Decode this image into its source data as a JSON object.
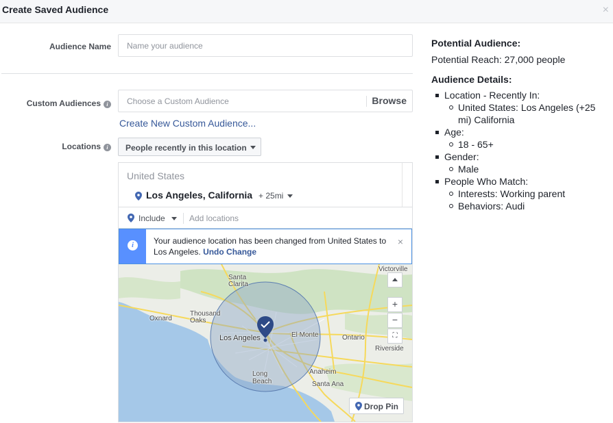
{
  "dialog": {
    "title": "Create Saved Audience",
    "close_icon": "×"
  },
  "form": {
    "audience_name": {
      "label": "Audience Name",
      "placeholder": "Name your audience"
    },
    "custom_audiences": {
      "label": "Custom Audiences",
      "placeholder": "Choose a Custom Audience",
      "browse_label": "Browse",
      "create_link": "Create New Custom Audience..."
    },
    "locations": {
      "label": "Locations",
      "dropdown_value": "People recently in this location",
      "country": "United States",
      "selected_location": "Los Angeles, California",
      "radius": "+ 25mi",
      "include_label": "Include",
      "add_placeholder": "Add locations",
      "notice": {
        "text": "Your audience location has been changed from United States to Los Angeles.",
        "undo_label": "Undo Change",
        "close": "×"
      }
    }
  },
  "map": {
    "labels": {
      "victorville": "Victorville",
      "santa_clarita": "Santa Clarita",
      "thousand_oaks": "Thousand Oaks",
      "oxnard": "Oxnard",
      "los_angeles": "Los Angeles",
      "el_monte": "El Monte",
      "ontario": "Ontario",
      "riverside": "Riverside",
      "long_beach": "Long Beach",
      "anaheim": "Anaheim",
      "santa_ana": "Santa Ana"
    },
    "zoom_in": "+",
    "zoom_out": "−",
    "drop_pin_label": "Drop Pin",
    "colors": {
      "water": "#a5c8e8",
      "land": "#eceee8",
      "green": "#cfe3c3",
      "road": "#f6d95b",
      "radius_fill": "#8ea6c8",
      "pin": "#3b5998"
    }
  },
  "summary": {
    "potential_heading": "Potential Audience:",
    "potential_reach": "Potential Reach: 27,000 people",
    "details_heading": "Audience Details:",
    "location_title": "Location - Recently In:",
    "location_value": "United States: Los Angeles (+25 mi) California",
    "age_title": "Age:",
    "age_value": "18 - 65+",
    "gender_title": "Gender:",
    "gender_value": "Male",
    "match_title": "People Who Match:",
    "interests": "Interests: Working parent",
    "behaviors": "Behaviors: Audi"
  }
}
